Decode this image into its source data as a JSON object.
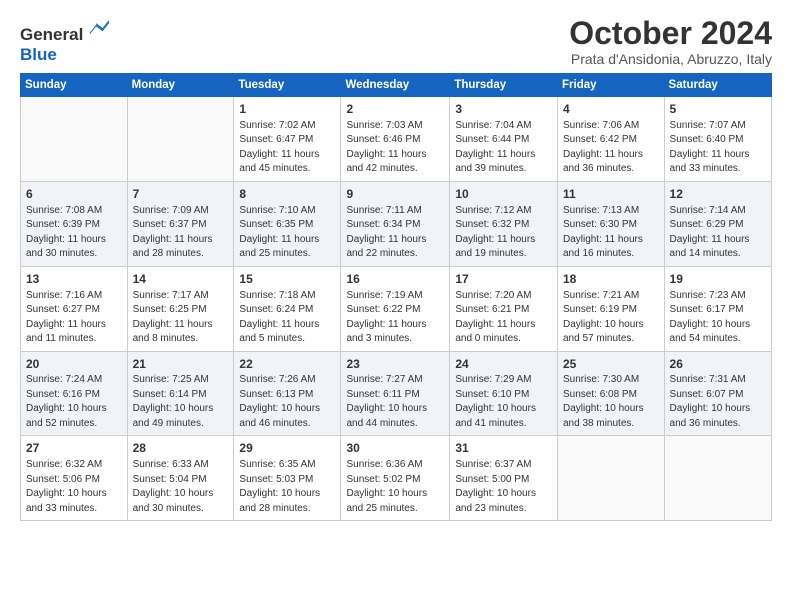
{
  "header": {
    "logo_line1": "General",
    "logo_line2": "Blue",
    "month": "October 2024",
    "location": "Prata d'Ansidonia, Abruzzo, Italy"
  },
  "days_of_week": [
    "Sunday",
    "Monday",
    "Tuesday",
    "Wednesday",
    "Thursday",
    "Friday",
    "Saturday"
  ],
  "weeks": [
    [
      {
        "day": "",
        "info": ""
      },
      {
        "day": "",
        "info": ""
      },
      {
        "day": "1",
        "info": "Sunrise: 7:02 AM\nSunset: 6:47 PM\nDaylight: 11 hours and 45 minutes."
      },
      {
        "day": "2",
        "info": "Sunrise: 7:03 AM\nSunset: 6:46 PM\nDaylight: 11 hours and 42 minutes."
      },
      {
        "day": "3",
        "info": "Sunrise: 7:04 AM\nSunset: 6:44 PM\nDaylight: 11 hours and 39 minutes."
      },
      {
        "day": "4",
        "info": "Sunrise: 7:06 AM\nSunset: 6:42 PM\nDaylight: 11 hours and 36 minutes."
      },
      {
        "day": "5",
        "info": "Sunrise: 7:07 AM\nSunset: 6:40 PM\nDaylight: 11 hours and 33 minutes."
      }
    ],
    [
      {
        "day": "6",
        "info": "Sunrise: 7:08 AM\nSunset: 6:39 PM\nDaylight: 11 hours and 30 minutes."
      },
      {
        "day": "7",
        "info": "Sunrise: 7:09 AM\nSunset: 6:37 PM\nDaylight: 11 hours and 28 minutes."
      },
      {
        "day": "8",
        "info": "Sunrise: 7:10 AM\nSunset: 6:35 PM\nDaylight: 11 hours and 25 minutes."
      },
      {
        "day": "9",
        "info": "Sunrise: 7:11 AM\nSunset: 6:34 PM\nDaylight: 11 hours and 22 minutes."
      },
      {
        "day": "10",
        "info": "Sunrise: 7:12 AM\nSunset: 6:32 PM\nDaylight: 11 hours and 19 minutes."
      },
      {
        "day": "11",
        "info": "Sunrise: 7:13 AM\nSunset: 6:30 PM\nDaylight: 11 hours and 16 minutes."
      },
      {
        "day": "12",
        "info": "Sunrise: 7:14 AM\nSunset: 6:29 PM\nDaylight: 11 hours and 14 minutes."
      }
    ],
    [
      {
        "day": "13",
        "info": "Sunrise: 7:16 AM\nSunset: 6:27 PM\nDaylight: 11 hours and 11 minutes."
      },
      {
        "day": "14",
        "info": "Sunrise: 7:17 AM\nSunset: 6:25 PM\nDaylight: 11 hours and 8 minutes."
      },
      {
        "day": "15",
        "info": "Sunrise: 7:18 AM\nSunset: 6:24 PM\nDaylight: 11 hours and 5 minutes."
      },
      {
        "day": "16",
        "info": "Sunrise: 7:19 AM\nSunset: 6:22 PM\nDaylight: 11 hours and 3 minutes."
      },
      {
        "day": "17",
        "info": "Sunrise: 7:20 AM\nSunset: 6:21 PM\nDaylight: 11 hours and 0 minutes."
      },
      {
        "day": "18",
        "info": "Sunrise: 7:21 AM\nSunset: 6:19 PM\nDaylight: 10 hours and 57 minutes."
      },
      {
        "day": "19",
        "info": "Sunrise: 7:23 AM\nSunset: 6:17 PM\nDaylight: 10 hours and 54 minutes."
      }
    ],
    [
      {
        "day": "20",
        "info": "Sunrise: 7:24 AM\nSunset: 6:16 PM\nDaylight: 10 hours and 52 minutes."
      },
      {
        "day": "21",
        "info": "Sunrise: 7:25 AM\nSunset: 6:14 PM\nDaylight: 10 hours and 49 minutes."
      },
      {
        "day": "22",
        "info": "Sunrise: 7:26 AM\nSunset: 6:13 PM\nDaylight: 10 hours and 46 minutes."
      },
      {
        "day": "23",
        "info": "Sunrise: 7:27 AM\nSunset: 6:11 PM\nDaylight: 10 hours and 44 minutes."
      },
      {
        "day": "24",
        "info": "Sunrise: 7:29 AM\nSunset: 6:10 PM\nDaylight: 10 hours and 41 minutes."
      },
      {
        "day": "25",
        "info": "Sunrise: 7:30 AM\nSunset: 6:08 PM\nDaylight: 10 hours and 38 minutes."
      },
      {
        "day": "26",
        "info": "Sunrise: 7:31 AM\nSunset: 6:07 PM\nDaylight: 10 hours and 36 minutes."
      }
    ],
    [
      {
        "day": "27",
        "info": "Sunrise: 6:32 AM\nSunset: 5:06 PM\nDaylight: 10 hours and 33 minutes."
      },
      {
        "day": "28",
        "info": "Sunrise: 6:33 AM\nSunset: 5:04 PM\nDaylight: 10 hours and 30 minutes."
      },
      {
        "day": "29",
        "info": "Sunrise: 6:35 AM\nSunset: 5:03 PM\nDaylight: 10 hours and 28 minutes."
      },
      {
        "day": "30",
        "info": "Sunrise: 6:36 AM\nSunset: 5:02 PM\nDaylight: 10 hours and 25 minutes."
      },
      {
        "day": "31",
        "info": "Sunrise: 6:37 AM\nSunset: 5:00 PM\nDaylight: 10 hours and 23 minutes."
      },
      {
        "day": "",
        "info": ""
      },
      {
        "day": "",
        "info": ""
      }
    ]
  ]
}
